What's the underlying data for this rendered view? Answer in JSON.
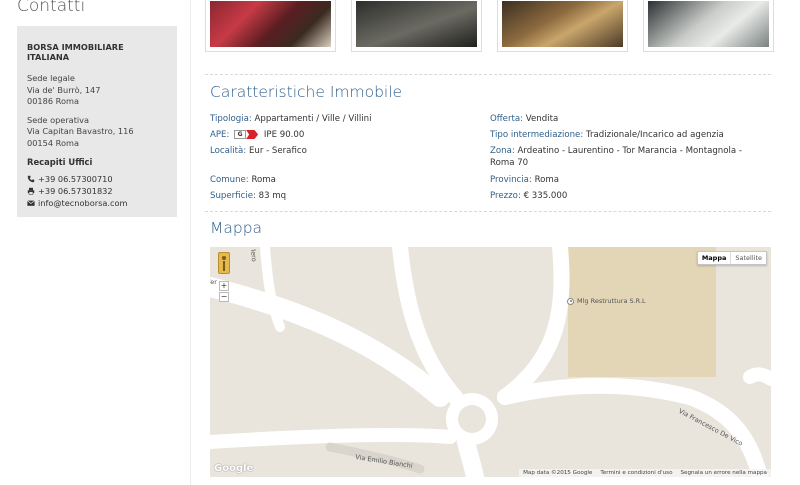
{
  "sidebar": {
    "title": "Contatti",
    "company": "BORSA IMMOBILIARE ITALIANA",
    "sede_legale_label": "Sede legale",
    "sede_legale_address": "Via de' Burrò, 147",
    "sede_legale_city": "00186 Roma",
    "sede_operativa_label": "Sede operativa",
    "sede_operativa_address": "Via Capitan Bavastro, 116",
    "sede_operativa_city": "00154 Roma",
    "recapiti_label": "Recapiti Uffici",
    "phone": "+39 06.57300710",
    "fax": "+39 06.57301832",
    "email": "info@tecnoborsa.com"
  },
  "gallery": {
    "photos": [
      "living-room",
      "corridor",
      "hallway",
      "bathroom"
    ]
  },
  "caratteristiche": {
    "title": "Caratteristiche Immobile",
    "tipologia_label": "Tipologia:",
    "tipologia_value": "Appartamenti / Ville / Villini",
    "ape_label": "APE:",
    "ape_class": "G",
    "ape_value": "IPE 90.00",
    "localita_label": "Località:",
    "localita_value": "Eur - Serafico",
    "comune_label": "Comune:",
    "comune_value": "Roma",
    "superficie_label": "Superficie:",
    "superficie_value": "83 mq",
    "offerta_label": "Offerta:",
    "offerta_value": "Vendita",
    "tipo_label": "Tipo intermediazione:",
    "tipo_value": "Tradizionale/Incarico ad agenzia",
    "zona_label": "Zona:",
    "zona_value_1": "Ardeatino - Laurentino - Tor Marancia - Montagnola -",
    "zona_value_2": "Roma 70",
    "provincia_label": "Provincia:",
    "provincia_value": "Roma",
    "prezzo_label": "Prezzo:",
    "prezzo_value": "€ 335.000"
  },
  "map": {
    "title": "Mappa",
    "type_map": "Mappa",
    "type_satellite": "Satellite",
    "zoom_in": "+",
    "zoom_out": "−",
    "poi_label": "Mlg Restruttura S.R.L",
    "road_vicuna": "Via Francesco De Vico",
    "road_bianchi": "Via Emilio Bianchi",
    "road_top": "lero",
    "road_left": "fer",
    "google_logo": "Google",
    "footer_data": "Map data ©2015 Google",
    "footer_terms": "Termini e condizioni d'uso",
    "footer_report": "Segnala un errore nella mappa"
  },
  "colors": {
    "accent": "#2f5f8a",
    "sidebar_bg": "#e8e8e8",
    "map_land": "#e9e5dc",
    "map_block": "#e2d6b6",
    "ape_red": "#d8232a"
  }
}
